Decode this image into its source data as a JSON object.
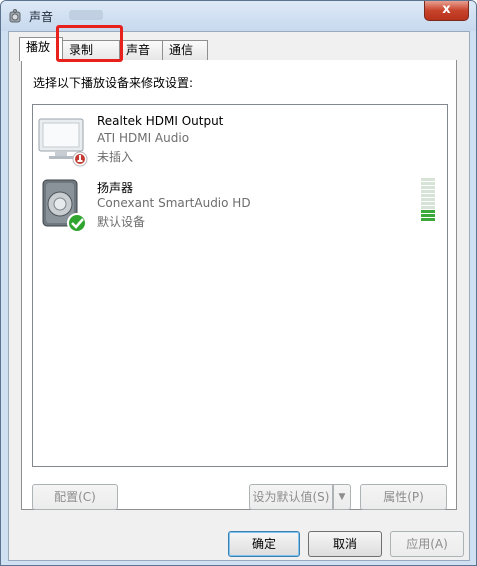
{
  "window": {
    "title": "声音",
    "close_label": "x",
    "icon": "speaker-icon"
  },
  "tabs": [
    {
      "label": "播放",
      "active": true
    },
    {
      "label": "录制",
      "active": false
    },
    {
      "label": "声音",
      "active": false
    },
    {
      "label": "通信",
      "active": false
    }
  ],
  "tabs_visible": {
    "t0": "播放",
    "t1": "录制",
    "t2": "声音",
    "t3": "通信"
  },
  "panel": {
    "instruction": "选择以下播放设备来修改设置:"
  },
  "devices": [
    {
      "name": "Realtek HDMI Output",
      "driver": "ATI HDMI Audio",
      "status": "未插入",
      "icon": "monitor-icon",
      "badge": "unplugged-badge-icon"
    },
    {
      "name": "扬声器",
      "driver": "Conexant SmartAudio HD",
      "status": "默认设备",
      "icon": "speaker-icon",
      "badge": "default-check-icon",
      "level_meter": {
        "bars_total": 11,
        "bars_lit": 3
      }
    }
  ],
  "buttons": {
    "configure": "配置(C)",
    "set_default": "设为默认值(S)",
    "properties": "属性(P)",
    "ok": "确定",
    "cancel": "取消",
    "apply": "应用(A)"
  },
  "colors": {
    "highlight": "#e8211c",
    "meter_lit": "#3aa83a",
    "meter_unlit": "#d6e3d6",
    "check_badge": "#2fa52f",
    "unplugged_badge": "#c23a30"
  }
}
